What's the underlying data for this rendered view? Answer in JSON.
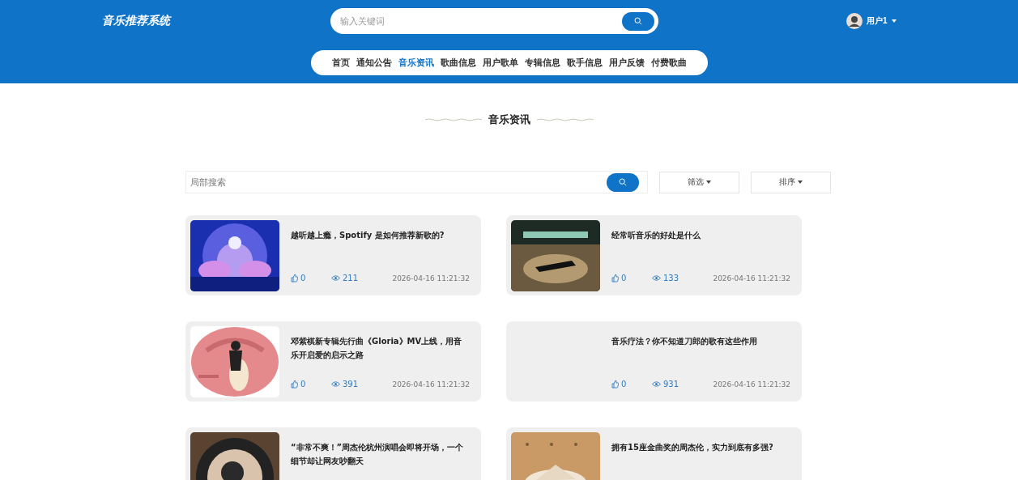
{
  "header": {
    "site_title": "音乐推荐系统",
    "search": {
      "placeholder": "输入关键词"
    },
    "user": {
      "name": "用户1"
    }
  },
  "nav": [
    {
      "label": "首页",
      "selected": false
    },
    {
      "label": "通知公告",
      "selected": false
    },
    {
      "label": "音乐资讯",
      "selected": true
    },
    {
      "label": "歌曲信息",
      "selected": false
    },
    {
      "label": "用户歌单",
      "selected": false
    },
    {
      "label": "专辑信息",
      "selected": false
    },
    {
      "label": "歌手信息",
      "selected": false
    },
    {
      "label": "用户反馈",
      "selected": false
    },
    {
      "label": "付费歌曲",
      "selected": false
    }
  ],
  "section_title": "音乐资讯",
  "toolbar": {
    "search": {
      "placeholder": "局部搜索"
    },
    "filter": "筛选",
    "sort": "排序"
  },
  "articles": [
    {
      "title": "越听越上瘾，Spotify 是如何推荐新歌的?",
      "likes": "0",
      "views": "211",
      "time": "2026-04-16 11:21:32"
    },
    {
      "title": "经常听音乐的好处是什么",
      "likes": "0",
      "views": "133",
      "time": "2026-04-16 11:21:32"
    },
    {
      "title": "邓紫棋新专辑先行曲《Gloria》MV上线，用音乐开启爱的启示之路",
      "likes": "0",
      "views": "391",
      "time": "2026-04-16 11:21:32"
    },
    {
      "title": "音乐疗法？你不知道刀郎的歌有这些作用",
      "likes": "0",
      "views": "931",
      "time": "2026-04-16 11:21:32"
    },
    {
      "title": "“非常不爽！”周杰伦杭州演唱会即将开场，一个细节却让网友吵翻天"
    },
    {
      "title": "拥有15座金曲奖的周杰伦，实力到底有多强?"
    }
  ]
}
